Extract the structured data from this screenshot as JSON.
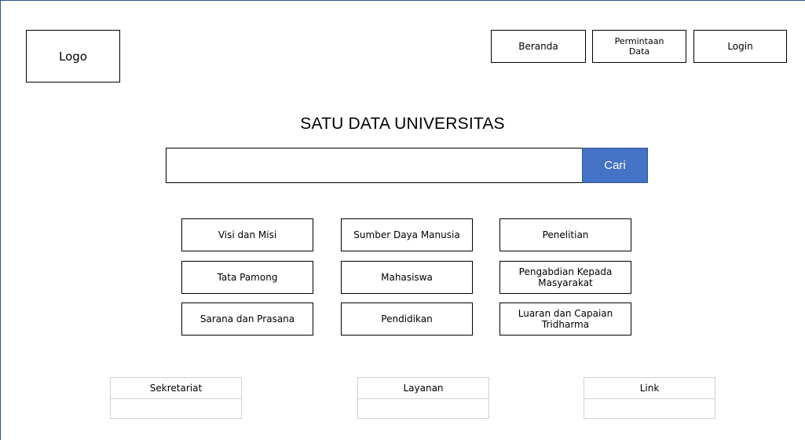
{
  "header": {
    "logo_text": "Logo",
    "nav": {
      "beranda": "Beranda",
      "permintaan_line1": "Permintaan",
      "permintaan_line2": "Data",
      "login": "Login"
    }
  },
  "main": {
    "title": "SATU DATA UNIVERSITAS",
    "search": {
      "placeholder": "",
      "value": "",
      "button_label": "Cari"
    },
    "categories": [
      {
        "line1": "Visi dan Misi",
        "line2": ""
      },
      {
        "line1": "Sumber Daya Manusia",
        "line2": ""
      },
      {
        "line1": "Penelitian",
        "line2": ""
      },
      {
        "line1": "Tata Pamong",
        "line2": ""
      },
      {
        "line1": "Mahasiswa",
        "line2": ""
      },
      {
        "line1": "Pengabdian Kepada",
        "line2": "Masyarakat"
      },
      {
        "line1": "Sarana dan Prasana",
        "line2": ""
      },
      {
        "line1": "Pendidikan",
        "line2": ""
      },
      {
        "line1": "Luaran dan Capaian",
        "line2": "Tridharma"
      }
    ]
  },
  "footer": {
    "sections": [
      {
        "title": "Sekretariat"
      },
      {
        "title": "Layanan"
      },
      {
        "title": "Link"
      }
    ]
  },
  "colors": {
    "accent": "#4472c4",
    "frame_border": "#2f5597",
    "footer_border": "#d0d0d0"
  }
}
